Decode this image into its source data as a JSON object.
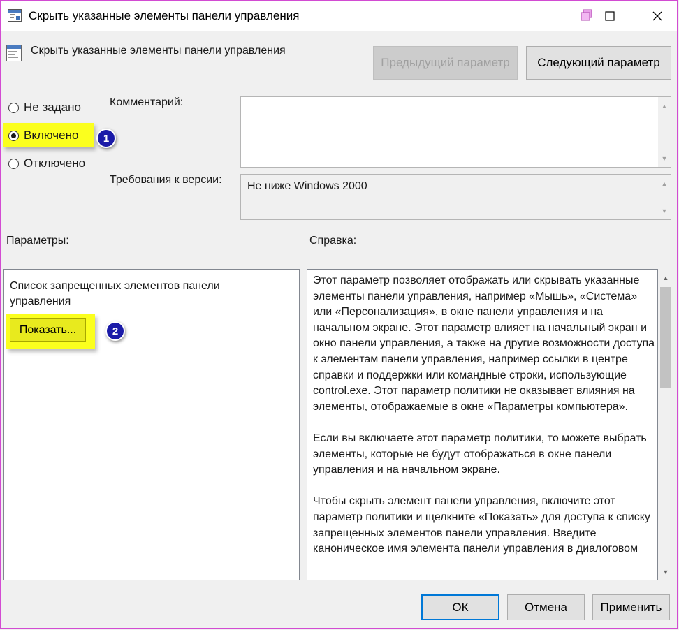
{
  "window": {
    "title": "Скрыть указанные элементы панели управления",
    "minimize_icon": "minimize-icon",
    "maximize_icon": "maximize-icon",
    "close_icon": "close-icon"
  },
  "header": {
    "policy_name": "Скрыть указанные элементы панели управления",
    "prev_label": "Предыдущий параметр",
    "next_label": "Следующий параметр"
  },
  "state": {
    "options": [
      "Не задано",
      "Включено",
      "Отключено"
    ],
    "selected": "Включено"
  },
  "comment": {
    "label": "Комментарий:",
    "value": ""
  },
  "version": {
    "label": "Требования к версии:",
    "value": "Не ниже Windows 2000"
  },
  "params": {
    "label": "Параметры:",
    "list_label": "Список запрещенных элементов панели управления",
    "show_label": "Показать..."
  },
  "help": {
    "label": "Справка:",
    "paragraphs": [
      "Этот параметр позволяет отображать или скрывать указанные элементы панели управления, например «Мышь», «Система» или «Персонализация», в окне панели управления и на начальном экране. Этот параметр влияет на начальный экран и окно панели управления, а также на другие возможности доступа к элементам панели управления, например ссылки в центре справки и поддержки или командные строки, использующие control.exe. Этот параметр политики не оказывает влияния на элементы, отображаемые в окне «Параметры компьютера».",
      "Если вы включаете этот параметр политики, то можете выбрать элементы, которые не будут отображаться в окне панели управления и на начальном экране.",
      "Чтобы скрыть элемент панели управления, включите этот параметр политики и щелкните «Показать» для доступа к списку запрещенных элементов панели управления. Введите каноническое имя элемента панели управления в диалоговом"
    ]
  },
  "annotations": {
    "step1": "1",
    "step2": "2",
    "highlight_color": "#fbff1e",
    "badge_color": "#1b1ba8"
  },
  "footer": {
    "ok_label": "ОК",
    "cancel_label": "Отмена",
    "apply_label": "Применить"
  }
}
